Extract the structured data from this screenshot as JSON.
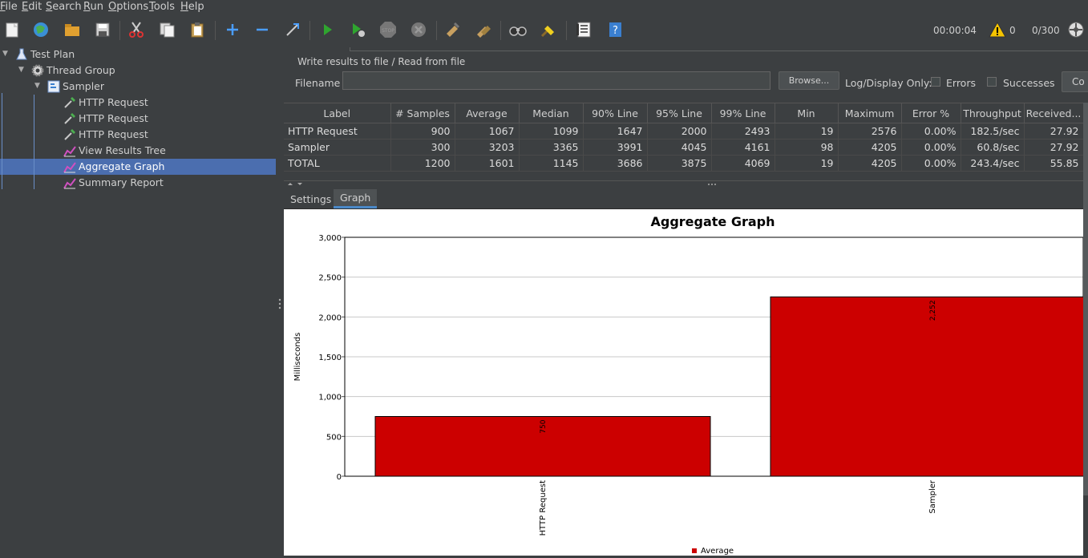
{
  "menu": [
    "File",
    "Edit",
    "Search",
    "Run",
    "Options",
    "Tools",
    "Help"
  ],
  "toolbar": {
    "timer": "00:00:04",
    "warnings": "0",
    "threads": "0/300",
    "icons": [
      "new-icon",
      "templates-icon",
      "open-icon",
      "save-icon",
      "cut-icon",
      "copy-icon",
      "paste-icon",
      "expand-icon",
      "collapse-icon",
      "toggle-icon",
      "start-icon",
      "start-no-pauses-icon",
      "stop-icon",
      "shutdown-icon",
      "clear-icon",
      "clear-all-icon",
      "search-icon",
      "reset-search-icon",
      "function-helper-icon",
      "help-icon"
    ]
  },
  "tree": [
    {
      "label": "Test Plan",
      "icon": "flask-icon",
      "depth": 0,
      "expanded": true
    },
    {
      "label": "Thread Group",
      "icon": "gear-icon",
      "depth": 1,
      "expanded": true
    },
    {
      "label": "Sampler",
      "icon": "controller-icon",
      "depth": 2,
      "expanded": true
    },
    {
      "label": "HTTP Request",
      "icon": "pipette-icon",
      "depth": 3
    },
    {
      "label": "HTTP Request",
      "icon": "pipette-icon",
      "depth": 3
    },
    {
      "label": "HTTP Request",
      "icon": "pipette-icon",
      "depth": 3
    },
    {
      "label": "View Results Tree",
      "icon": "graph-icon",
      "depth": 3
    },
    {
      "label": "Aggregate Graph",
      "icon": "graph-icon",
      "depth": 3,
      "selected": true
    },
    {
      "label": "Summary Report",
      "icon": "graph-icon",
      "depth": 3
    }
  ],
  "results": {
    "section_title": "Write results to file / Read from file",
    "filename_label": "Filename",
    "filename_value": "",
    "browse_label": "Browse...",
    "log_display_label": "Log/Display Only:",
    "errors_label": "Errors",
    "successes_label": "Successes",
    "configure_label": "Co"
  },
  "table": {
    "columns": [
      "Label",
      "# Samples",
      "Average",
      "Median",
      "90% Line",
      "95% Line",
      "99% Line",
      "Min",
      "Maximum",
      "Error %",
      "Throughput",
      "Received..."
    ],
    "rows": [
      [
        "HTTP Request",
        "900",
        "1067",
        "1099",
        "1647",
        "2000",
        "2493",
        "19",
        "2576",
        "0.00%",
        "182.5/sec",
        "27.92"
      ],
      [
        "Sampler",
        "300",
        "3203",
        "3365",
        "3991",
        "4045",
        "4161",
        "98",
        "4205",
        "0.00%",
        "60.8/sec",
        "27.92"
      ],
      [
        "TOTAL",
        "1200",
        "1601",
        "1145",
        "3686",
        "3875",
        "4069",
        "19",
        "4205",
        "0.00%",
        "243.4/sec",
        "55.85"
      ]
    ]
  },
  "tabs": {
    "settings": "Settings",
    "graph": "Graph"
  },
  "chart_data": {
    "type": "bar",
    "title": "Aggregate Graph",
    "xlabel": "",
    "ylabel": "Milliseconds",
    "ylim": [
      0,
      3000
    ],
    "yticks": [
      0,
      500,
      1000,
      1500,
      2000,
      2500,
      3000
    ],
    "ytick_labels": [
      "0",
      "500",
      "1,000",
      "1,500",
      "2,000",
      "2,500",
      "3,000"
    ],
    "categories": [
      "HTTP Request",
      "Sampler"
    ],
    "series": [
      {
        "name": "Average",
        "values": [
          750,
          2252
        ],
        "value_labels": [
          "750",
          "2,252"
        ],
        "color": "#cc0000"
      }
    ],
    "legend": "bottom",
    "grid": true
  }
}
